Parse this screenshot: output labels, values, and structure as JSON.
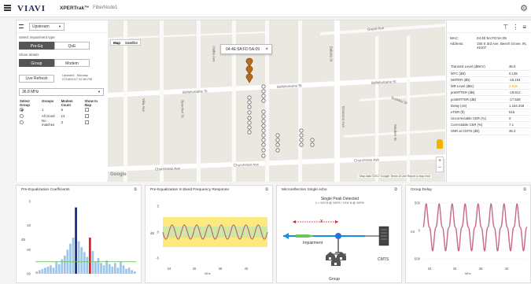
{
  "app": {
    "brand": "VIAVI",
    "product": "XPERTrak™",
    "node": "FiberNode1"
  },
  "left_panel": {
    "direction": "Upstream",
    "impairment_label": "Select impairment type",
    "impairment_buttons": [
      "Pre-Eq",
      "QoE"
    ],
    "show_details_label": "Show details",
    "detail_buttons": [
      "Group",
      "Modem"
    ],
    "live_refresh": "Live Refresh",
    "updated_line1": "Updated - Monday",
    "updated_line2": "07/08/2017 02:50 PM",
    "frequency": "36.8 MHz",
    "table_headers": [
      "Select Group",
      "Groups",
      "Modem Count",
      "Show In Map"
    ],
    "rows": [
      {
        "group": "1",
        "count": "6",
        "selected": true
      },
      {
        "group": "All Good",
        "count": "14",
        "selected": false
      },
      {
        "group": "No matches",
        "count": "3",
        "selected": false
      }
    ]
  },
  "map": {
    "tabs": [
      "Map",
      "Satellite"
    ],
    "tooltip": "04:4E:5A:FD:5A:09",
    "streets": [
      "Bellefontaine St",
      "Bellefontaine St",
      "Bellefontaine St",
      "Churchman Ave",
      "Churchman Ave",
      "Churchman Ave",
      "Emerson Ave",
      "Grand Ave",
      "Buckley St",
      "Manker St",
      "Villa Ave",
      "Beecher St",
      "Ouilia Ave",
      "Dakota St"
    ],
    "google": "Google",
    "attribution": "Map data ©2017 Google  Terms of Use  Report a map error"
  },
  "right_panel": {
    "mac_label": "MAC:",
    "mac_value": "04:4E:5A:FD:5A:09",
    "address_label": "Address:",
    "address_value": "150 S 3rd Ave, Beech Grove, IN, 46107",
    "measurements": [
      {
        "name": "Transmit Level (dBmV)",
        "value": "36.5",
        "warn": false
      },
      {
        "name": "MTC (dB)",
        "value": "0.135",
        "warn": false
      },
      {
        "name": "NMTER (dB)",
        "value": "-15.154",
        "warn": false
      },
      {
        "name": "MR Level (dBc)",
        "value": "2.818",
        "warn": true
      },
      {
        "name": "preMTTER (dB)",
        "value": "-19.912",
        "warn": false
      },
      {
        "name": "postMTTER (dB)",
        "value": "-17.528",
        "warn": false
      },
      {
        "name": "Delay (nS)",
        "value": "1.164.348",
        "warn": false
      },
      {
        "name": "eTDR (ft)",
        "value": "515",
        "warn": false
      },
      {
        "name": "Uncorrectable CER (%)",
        "value": "0",
        "warn": false
      },
      {
        "name": "Correctable CER (%)",
        "value": "7.1",
        "warn": false
      },
      {
        "name": "SNR at CMTS (dB)",
        "value": "36.3",
        "warn": false
      }
    ]
  },
  "charts": {
    "coeff": {
      "title": "Pre-Equalization Coefficients",
      "ylabel": "dB",
      "yticks": [
        "0",
        "-20",
        "-40",
        "-60"
      ],
      "bars": [
        -58,
        -57,
        -56,
        -55,
        -54,
        -53,
        -55,
        -50,
        -52,
        -48,
        -45,
        -40,
        -35,
        -30,
        -5,
        -33,
        -38,
        -42,
        -46,
        -30,
        -41,
        -50,
        -47,
        -51,
        -53,
        -49,
        -52,
        -54,
        -51,
        -55,
        -50,
        -53,
        -56,
        -55,
        -57,
        -58
      ],
      "main_index": 14,
      "second_index": 19
    },
    "freq": {
      "title": "Pre-Equalization In Band Frequency Response",
      "ylabel": "dB",
      "xlabel": "MHz",
      "yticks": [
        "5",
        "0",
        "-5"
      ],
      "xticks": [
        "34",
        "36",
        "38",
        "40"
      ]
    },
    "micro": {
      "title": "Microreflection Single echo",
      "heading": "Single Peak Detected",
      "subheading": "x = 510 ft @ 100% / 1011 ft @ 100%",
      "x_label": "X",
      "impairment_label": "Impairment",
      "cmts_label": "CMTS",
      "group_label": "Group"
    },
    "delay": {
      "title": "Group Delay",
      "ylabel": "nS",
      "xlabel": "MHz",
      "yticks": [
        "500",
        "0",
        "-500"
      ],
      "xticks": [
        "34",
        "36",
        "38",
        "40"
      ]
    }
  },
  "colors": {
    "accent_dark": "#555555",
    "warn": "#d4a017",
    "bar_main": "#1a2b8a",
    "bar_second": "#e02020",
    "bar_normal": "#9ec6e8",
    "response": "#b85c8a",
    "delay": "#c05a78"
  }
}
